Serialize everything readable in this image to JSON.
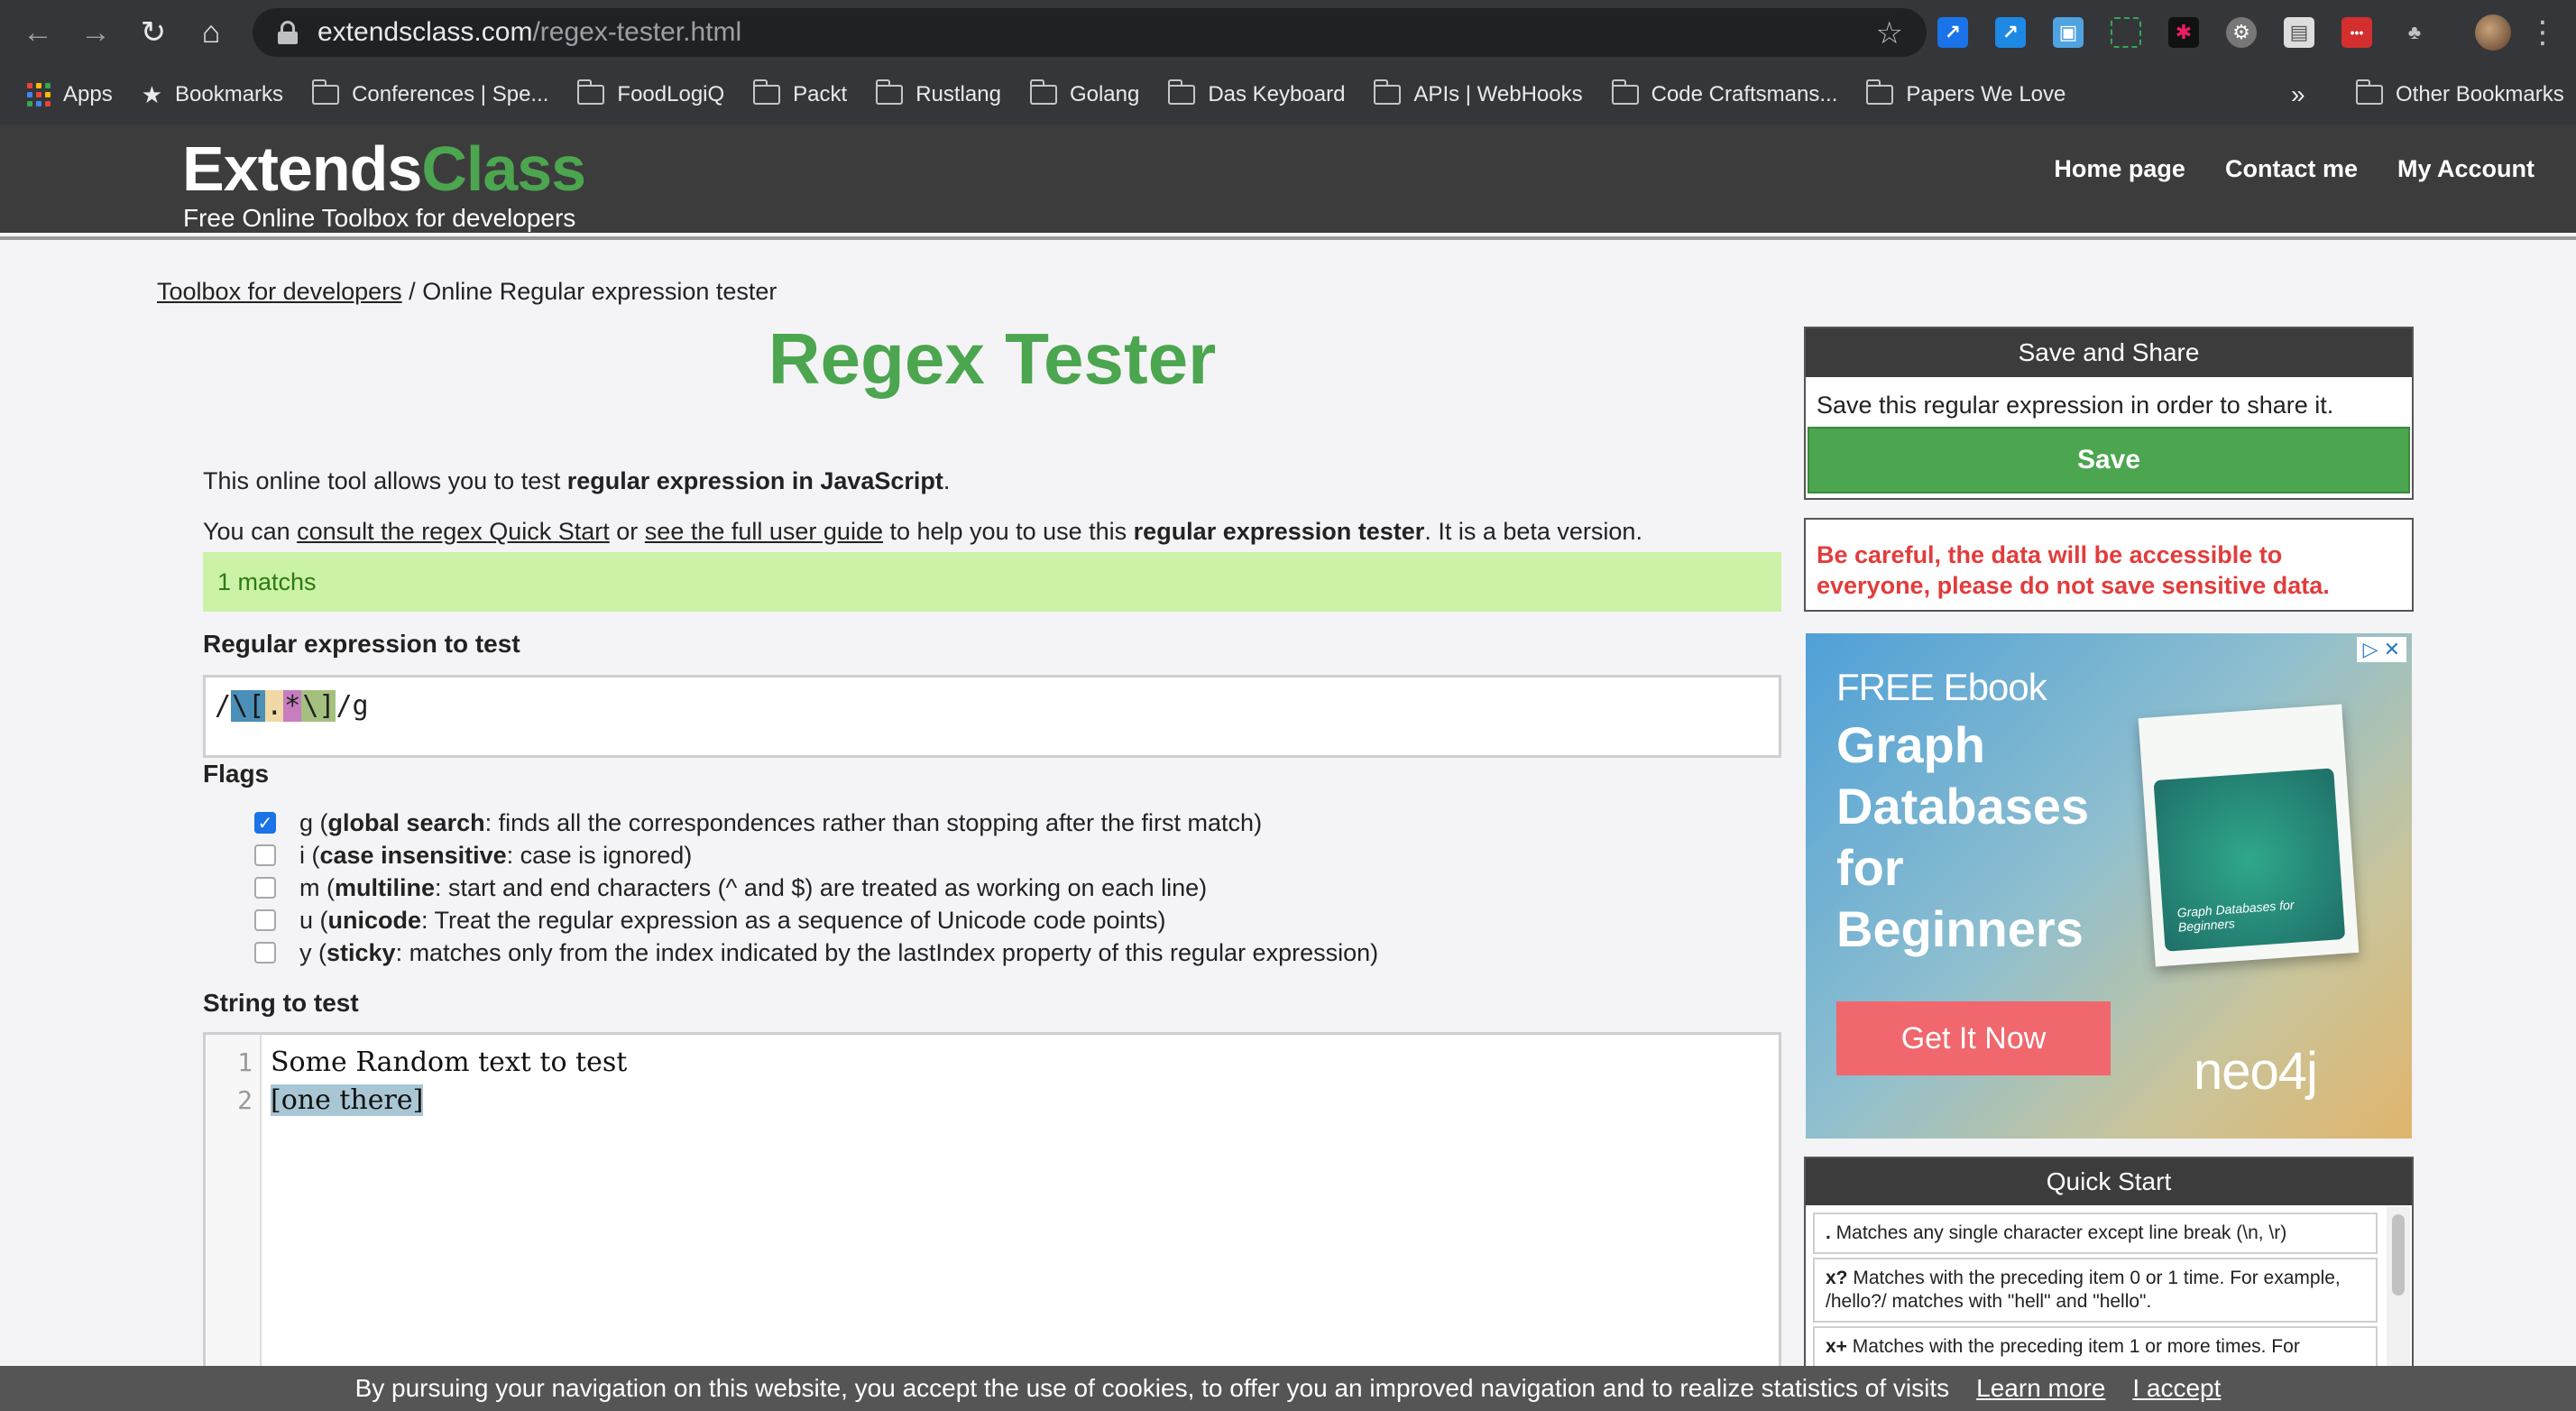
{
  "browser": {
    "url_domain": "extendsclass.com",
    "url_path": "/regex-tester.html",
    "bookmarks": [
      {
        "label": "Apps",
        "icon": "apps-grid-icon"
      },
      {
        "label": "Bookmarks",
        "icon": "star-icon"
      },
      {
        "label": "Conferences | Spe...",
        "icon": "folder-icon"
      },
      {
        "label": "FoodLogiQ",
        "icon": "folder-icon"
      },
      {
        "label": "Packt",
        "icon": "folder-icon"
      },
      {
        "label": "Rustlang",
        "icon": "folder-icon"
      },
      {
        "label": "Golang",
        "icon": "folder-icon"
      },
      {
        "label": "Das Keyboard",
        "icon": "folder-icon"
      },
      {
        "label": "APIs | WebHooks",
        "icon": "folder-icon"
      },
      {
        "label": "Code Craftsmans...",
        "icon": "folder-icon"
      },
      {
        "label": "Papers We Love",
        "icon": "folder-icon"
      }
    ],
    "overflow": "»",
    "other_bookmarks": "Other Bookmarks"
  },
  "site": {
    "logo_extends": "Extends",
    "logo_class": "Class",
    "tagline": "Free Online Toolbox for developers",
    "nav": [
      "Home page",
      "Contact me",
      "My Account"
    ]
  },
  "breadcrumb": {
    "link": "Toolbox for developers",
    "separator": " / ",
    "current": "Online Regular expression tester"
  },
  "main": {
    "title": "Regex Tester",
    "intro_prefix": "This online tool allows you to test ",
    "intro_bold": "regular expression in JavaScript",
    "intro_suffix": ".",
    "help_1": "You can ",
    "help_link_1": "consult the regex Quick Start",
    "help_2": " or ",
    "help_link_2": "see the full user guide",
    "help_3": " to help you to use this ",
    "help_bold": "regular expression tester",
    "help_4": ". It is a beta version.",
    "match_status": "1 matchs",
    "regex_label": "Regular expression to test",
    "regex_open": "/",
    "regex_tokens": [
      "\\[",
      ".",
      "*",
      "\\]"
    ],
    "regex_close": "/g",
    "flags_label": "Flags",
    "flags": [
      {
        "letter": "g",
        "name": "global search",
        "desc": ": finds all the correspondences rather than stopping after the first match)",
        "checked": true
      },
      {
        "letter": "i",
        "name": "case insensitive",
        "desc": ": case is ignored)",
        "checked": false
      },
      {
        "letter": "m",
        "name": "multiline",
        "desc": ": start and end characters (^ and $) are treated as working on each line)",
        "checked": false
      },
      {
        "letter": "u",
        "name": "unicode",
        "desc": ": Treat the regular expression as a sequence of Unicode code points)",
        "checked": false
      },
      {
        "letter": "y",
        "name": "sticky",
        "desc": ": matches only from the index indicated by the lastIndex property of this regular expression)",
        "checked": false
      }
    ],
    "string_label": "String to test",
    "lines": [
      "1",
      "2"
    ],
    "line_1": "Some Random text to test",
    "line_2": "[one there]"
  },
  "sidebar": {
    "save_title": "Save and Share",
    "save_text": "Save this regular expression in order to share it.",
    "save_button": "Save",
    "warning": "Be careful, the data will be accessible to everyone, please do not save sensitive data.",
    "ad": {
      "kicker": "FREE Ebook",
      "title_lines": [
        "Graph",
        "Databases",
        "for",
        "Beginners"
      ],
      "book_label": "Graph Databases for Beginners",
      "cta": "Get It Now",
      "brand": "neo4j"
    },
    "quick_start_title": "Quick Start",
    "quick_start": [
      {
        "key": ".",
        "text": " Matches any single character except line break (\\n, \\r)"
      },
      {
        "key": "x?",
        "text": " Matches with the preceding item 0 or 1 time. For example, /hello?/ matches with \"hell\" and \"hello\"."
      },
      {
        "key": "x+",
        "text": " Matches with the preceding item 1 or more times. For"
      }
    ]
  },
  "cookie": {
    "text": "By pursuing your navigation on this website, you accept the use of cookies, to offer you an improved navigation and to realize statistics of visits",
    "learn_more": "Learn more",
    "accept": "I accept"
  },
  "colors": {
    "brand_green": "#4ca54f",
    "header_dark": "#3c3c3c",
    "match_bg": "#cbf2a6",
    "warning_red": "#e23c3c"
  }
}
